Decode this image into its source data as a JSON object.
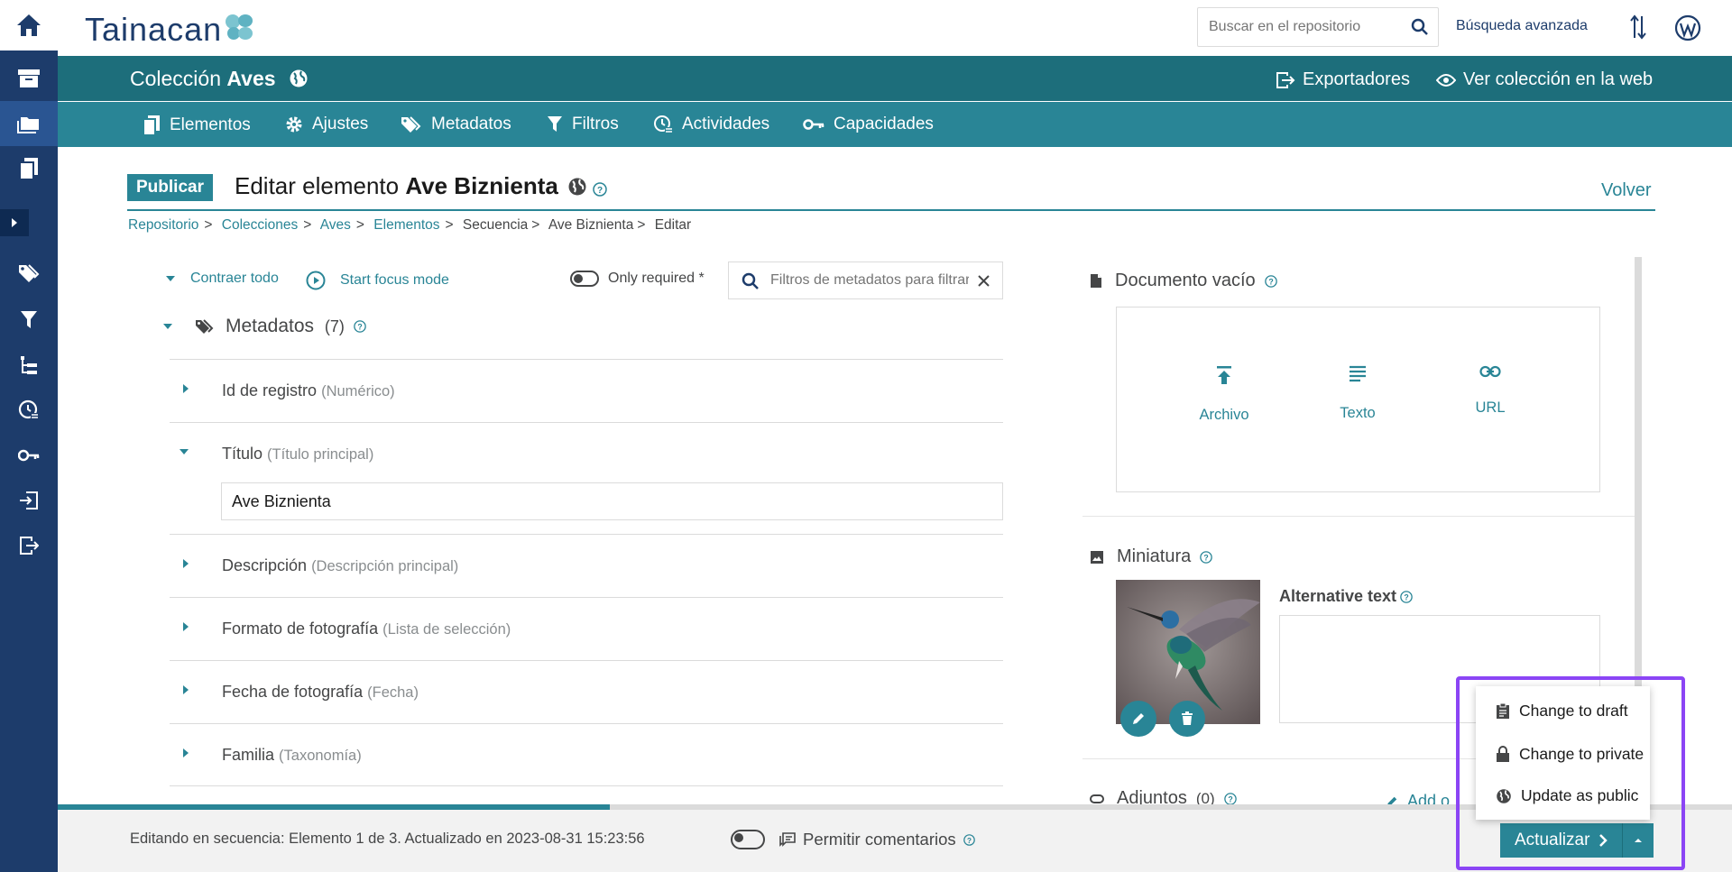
{
  "topbar": {
    "logo_text": "Tainacan",
    "search_placeholder": "Buscar en el repositorio",
    "advanced_search": "Búsqueda avanzada"
  },
  "collection": {
    "prefix": "Colección",
    "name": "Aves",
    "exporters": "Exportadores",
    "view_web": "Ver colección en la web"
  },
  "tabs": [
    {
      "label": "Elementos",
      "icon": "files-icon"
    },
    {
      "label": "Ajustes",
      "icon": "gear-icon"
    },
    {
      "label": "Metadatos",
      "icon": "tags-icon"
    },
    {
      "label": "Filtros",
      "icon": "filter-icon"
    },
    {
      "label": "Actividades",
      "icon": "activity-icon"
    },
    {
      "label": "Capacidades",
      "icon": "key-icon"
    }
  ],
  "page": {
    "status_tag": "Publicar",
    "title_prefix": "Editar elemento",
    "title_name": "Ave Biznienta",
    "back": "Volver"
  },
  "breadcrumb": [
    {
      "label": "Repositorio",
      "link": true
    },
    {
      "label": "Colecciones",
      "link": true
    },
    {
      "label": "Aves",
      "link": true
    },
    {
      "label": "Elementos",
      "link": true
    },
    {
      "label": "Secuencia",
      "link": false
    },
    {
      "label": "Ave Biznienta",
      "link": false
    },
    {
      "label": "Editar",
      "link": false
    }
  ],
  "form_controls": {
    "collapse_all": "Contraer todo",
    "focus_mode": "Start focus mode",
    "only_required": "Only required *",
    "filter_placeholder": "Filtros de metadatos para filtrar"
  },
  "metadata_section": {
    "title": "Metadatos",
    "count": "(7)",
    "items": [
      {
        "label": "Id de registro",
        "type": "(Numérico)",
        "open": false
      },
      {
        "label": "Título",
        "type": "(Título principal)",
        "open": true,
        "value": "Ave Biznienta"
      },
      {
        "label": "Descripción",
        "type": "(Descripción principal)",
        "open": false
      },
      {
        "label": "Formato de fotografía",
        "type": "(Lista de selección)",
        "open": false
      },
      {
        "label": "Fecha de fotografía",
        "type": "(Fecha)",
        "open": false
      },
      {
        "label": "Familia",
        "type": "(Taxonomía)",
        "open": false
      }
    ]
  },
  "document": {
    "title": "Documento vacío",
    "options": [
      {
        "label": "Archivo",
        "icon": "upload-icon"
      },
      {
        "label": "Texto",
        "icon": "text-icon"
      },
      {
        "label": "URL",
        "icon": "link-icon"
      }
    ]
  },
  "thumbnail": {
    "title": "Miniatura",
    "alt_label": "Alternative text"
  },
  "attachments": {
    "title": "Adjuntos",
    "count": "(0)",
    "add_label": "Add o"
  },
  "footer": {
    "status": "Editando en secuencia: Elemento 1 de 3. Actualizado en 2023-08-31 15:23:56",
    "comments": "Permitir comentarios",
    "update": "Actualizar",
    "progress_fraction": 0.33
  },
  "dropdown": {
    "items": [
      {
        "label": "Change to draft",
        "icon": "clipboard-icon"
      },
      {
        "label": "Change to private",
        "icon": "lock-icon"
      },
      {
        "label": "Update as public",
        "icon": "globe-icon"
      }
    ]
  },
  "colors": {
    "sidebar": "#1d3c6b",
    "collection_bar": "#1d6e7b",
    "tab_bar": "#298596",
    "accent": "#298596",
    "highlight": "#8b45f5"
  }
}
